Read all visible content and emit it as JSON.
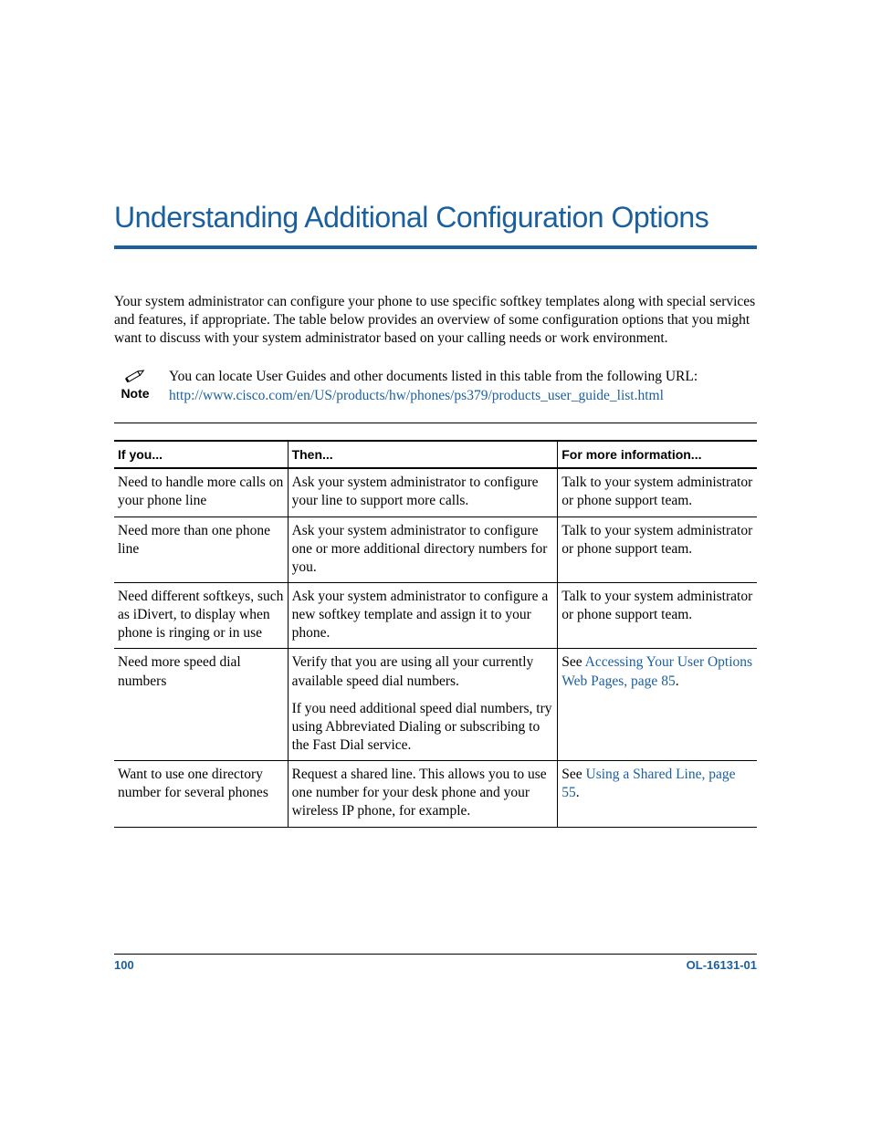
{
  "title": "Understanding Additional Configuration Options",
  "intro": "Your system administrator can configure your phone to use specific softkey templates along with special services and features, if appropriate. The table below provides an overview of some configuration options that you might want to discuss with your system administrator based on your calling needs or work environment.",
  "note": {
    "label": "Note",
    "text": "You can locate User Guides and other documents listed in this table from the following URL:",
    "url": "http://www.cisco.com/en/US/products/hw/phones/ps379/products_user_guide_list.html"
  },
  "table": {
    "headers": {
      "c1": "If you...",
      "c2": "Then...",
      "c3": "For more information..."
    },
    "rows": [
      {
        "c1": "Need to handle more calls on your phone line",
        "c2": "Ask your system administrator to configure your line to support more calls.",
        "c3_text": "Talk to your system administrator or phone support team."
      },
      {
        "c1": "Need more than one phone line",
        "c2": "Ask your system administrator to configure one or more additional directory numbers for you.",
        "c3_text": "Talk to your system administrator or phone support team."
      },
      {
        "c1": "Need different softkeys, such as iDivert, to display when phone is ringing or in use",
        "c2": "Ask your system administrator to configure a new softkey template and assign it to your phone.",
        "c3_text": "Talk to your system administrator or phone support team."
      },
      {
        "c1": "Need more speed dial numbers",
        "c2a": "Verify that you are using all your currently available speed dial numbers.",
        "c2b": "If you need additional speed dial numbers, try using Abbreviated Dialing or subscribing to the Fast Dial service.",
        "c3_prefix": "See ",
        "c3_link": "Accessing Your User Options Web Pages, page 85",
        "c3_suffix": "."
      },
      {
        "c1": "Want to use one directory number for several phones",
        "c2": "Request a shared line. This allows you to use one number for your desk phone and your wireless IP phone, for example.",
        "c3_prefix": "See ",
        "c3_link": "Using a Shared Line, page 55",
        "c3_suffix": "."
      }
    ]
  },
  "footer": {
    "page": "100",
    "docid": "OL-16131-01"
  }
}
